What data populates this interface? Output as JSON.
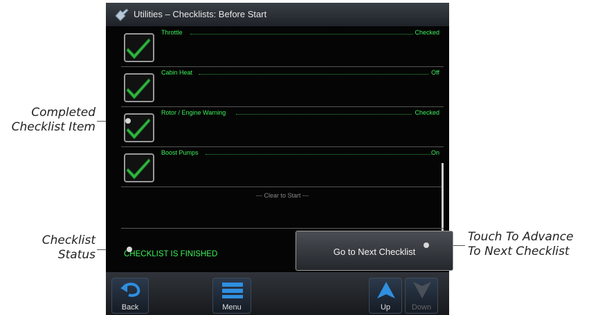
{
  "title": "Utilities – Checklists: Before Start",
  "items": [
    {
      "label": "Throttle",
      "value": "Checked",
      "icon": "checkmark-icon"
    },
    {
      "label": "Cabin Heat",
      "value": "Off",
      "icon": "checkmark-icon"
    },
    {
      "label": "Rotor / Engine Warning",
      "value": "Checked",
      "icon": "checkmark-icon"
    },
    {
      "label": "Boost Pumps",
      "value": "On",
      "icon": "checkmark-icon"
    }
  ],
  "clear_text": "--- Clear to Start ---",
  "status": "CHECKLIST IS FINISHED",
  "next_button": "Go to Next Checklist",
  "softkeys": [
    {
      "label": "Back",
      "icon": "back-arrow-icon"
    },
    {
      "label": "Menu",
      "icon": "menu-icon"
    },
    {
      "label": "Up",
      "icon": "up-arrow-icon"
    },
    {
      "label": "Down",
      "icon": "down-arrow-icon"
    }
  ],
  "callouts": {
    "completed_item": [
      "Completed",
      "Checklist Item"
    ],
    "status": [
      "Checklist",
      "Status"
    ],
    "advance": [
      "Touch To Advance",
      "To Next Checklist"
    ]
  },
  "colors": {
    "checked_text": "#3cf05a",
    "check_icon": "#2fb83f"
  }
}
